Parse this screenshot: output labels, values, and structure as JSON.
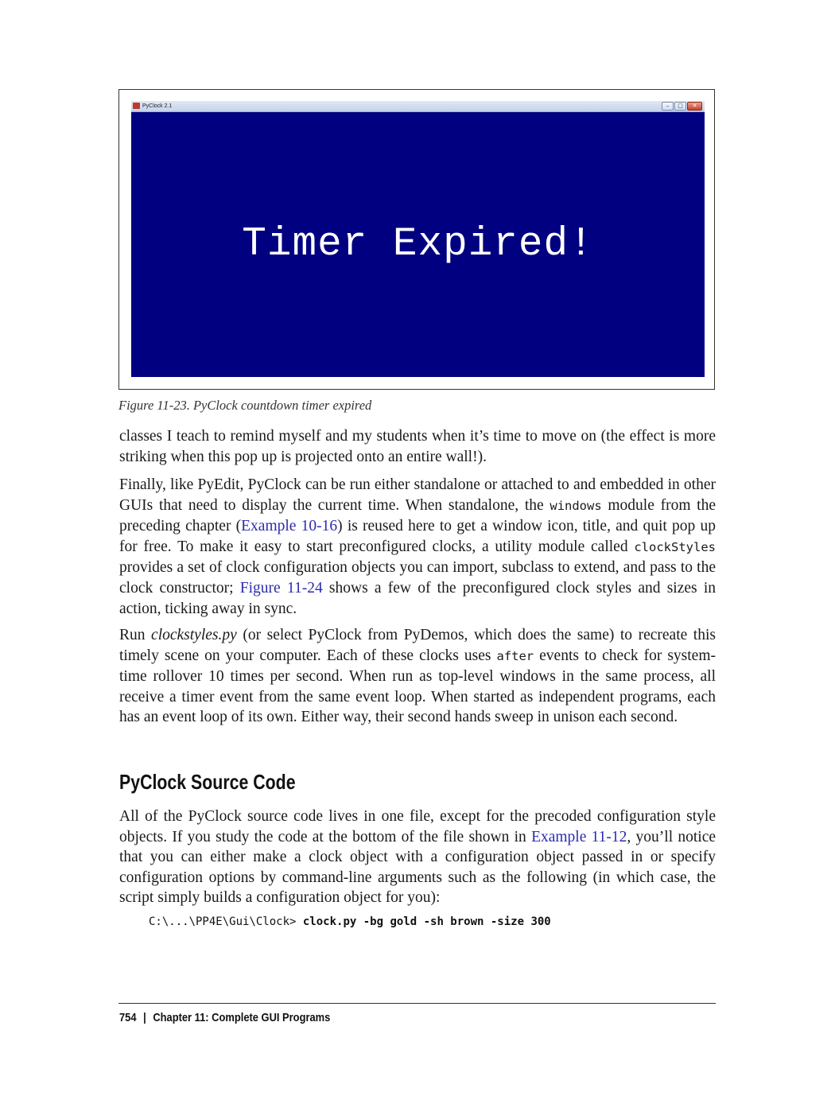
{
  "figure": {
    "window_title": "PyClock 2.1",
    "window_buttons": {
      "minimize": "–",
      "maximize": "□",
      "close": "✕"
    },
    "display_text": "Timer Expired!",
    "background_color": "#000080",
    "text_color": "#ffffff",
    "caption": "Figure 11-23. PyClock countdown timer expired"
  },
  "para1": "classes I teach to remind myself and my students when it’s time to move on (the effect is more striking when this pop up is projected onto an entire wall!).",
  "para2": {
    "t1": "Finally, like PyEdit, PyClock can be run either standalone or attached to and embedded in other GUIs that need to display the current time. When standalone, the ",
    "code1": "windows",
    "t2": " module from the preceding chapter (",
    "link1": "Example 10-16",
    "t3": ") is reused here to get a window icon, title, and quit pop up for free. To make it easy to start preconfigured clocks, a utility module called ",
    "code2": "clockStyles",
    "t4": " provides a set of clock configuration objects you can import, subclass to extend, and pass to the clock constructor; ",
    "link2": "Figure 11-24",
    "t5": " shows a few of the preconfigured clock styles and sizes in action, ticking away in sync."
  },
  "para3": {
    "t1": "Run ",
    "em1": "clockstyles.py",
    "t2": " (or select PyClock from PyDemos, which does the same) to recreate this timely scene on your computer. Each of these clocks uses ",
    "code1": "after",
    "t3": " events to check for system-time rollover 10 times per second. When run as top-level windows in the same process, all receive a timer event from the same event loop. When started as independent programs, each has an event loop of its own. Either way, their second hands sweep in unison each second."
  },
  "heading": "PyClock Source Code",
  "para4": {
    "t1": "All of the PyClock source code lives in one file, except for the precoded configuration style objects. If you study the code at the bottom of the file shown in ",
    "link1": "Example 11-12",
    "t2": ", you’ll notice that you can either make a clock object with a configuration object passed in or specify configuration options by command-line arguments such as the following (in which case, the script simply builds a configuration object for you):"
  },
  "command": {
    "prompt": "C:\\...\\PP4E\\Gui\\Clock> ",
    "input": "clock.py -bg gold -sh brown -size 300"
  },
  "footer": {
    "page_number": "754",
    "separator": "|",
    "chapter": "Chapter 11: Complete GUI Programs"
  }
}
